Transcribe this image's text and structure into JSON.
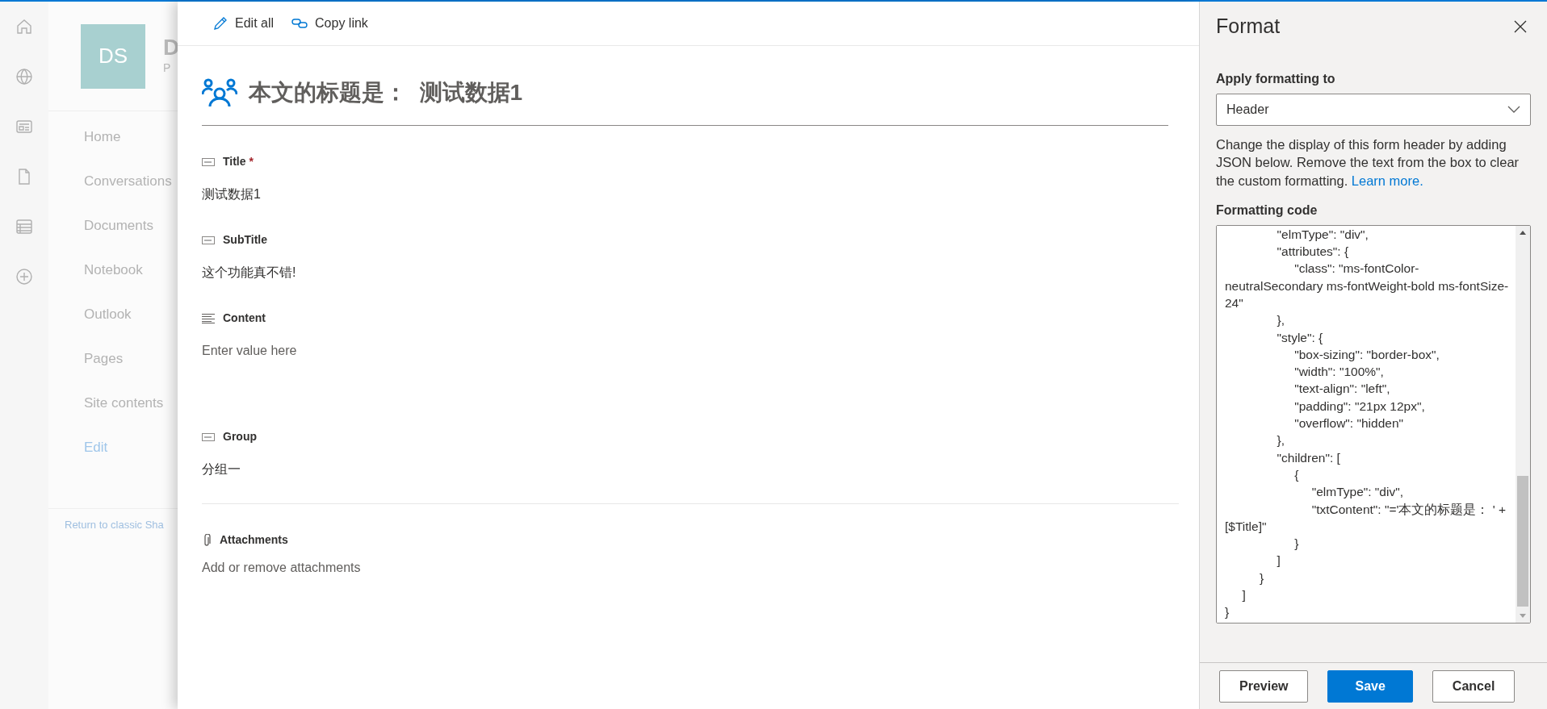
{
  "app_rail": {
    "items": [
      {
        "kind": "home"
      },
      {
        "kind": "globe"
      },
      {
        "kind": "news"
      },
      {
        "kind": "file"
      },
      {
        "kind": "list"
      },
      {
        "kind": "add"
      }
    ]
  },
  "site": {
    "logo": "DS",
    "title": "D",
    "subtitle": "P",
    "nav": [
      {
        "label": "Home",
        "kind": "link"
      },
      {
        "label": "Conversations",
        "kind": "link"
      },
      {
        "label": "Documents",
        "kind": "link"
      },
      {
        "label": "Notebook",
        "kind": "link"
      },
      {
        "label": "Outlook",
        "kind": "link"
      },
      {
        "label": "Pages",
        "kind": "link"
      },
      {
        "label": "Site contents",
        "kind": "link"
      },
      {
        "label": "Edit",
        "kind": "action"
      }
    ],
    "classic_link": "Return to classic Sha"
  },
  "form": {
    "toolbar": [
      {
        "label": "Edit all",
        "kind": "edit"
      },
      {
        "label": "Copy link",
        "kind": "link"
      }
    ],
    "header": "本文的标题是：  测试数据1",
    "fields": [
      {
        "label": "Title",
        "kind": "text",
        "required_mark": "*",
        "value": "测试数据1"
      },
      {
        "label": "SubTitle",
        "kind": "text",
        "value": "这个功能真不错!"
      },
      {
        "label": "Content",
        "kind": "multiline",
        "placeholder": "Enter value here"
      },
      {
        "label": "Group",
        "kind": "text",
        "value": "分组一"
      }
    ],
    "attachments": {
      "label": "Attachments",
      "action": "Add or remove attachments"
    }
  },
  "format_panel": {
    "title": "Format",
    "apply_label": "Apply formatting to",
    "apply_value": "Header",
    "description": "Change the display of this form header by adding JSON below. Remove the text from the box to clear the custom formatting.",
    "learn_more": "Learn more.",
    "code_label": "Formatting code",
    "code_lines": [
      "               \"elmType\": \"div\",",
      "               \"attributes\": {",
      "                    \"class\": \"ms-fontColor-neutralSecondary ms-fontWeight-bold ms-fontSize-24\"",
      "               },",
      "               \"style\": {",
      "                    \"box-sizing\": \"border-box\",",
      "                    \"width\": \"100%\",",
      "                    \"text-align\": \"left\",",
      "                    \"padding\": \"21px 12px\",",
      "                    \"overflow\": \"hidden\"",
      "               },",
      "               \"children\": [",
      "                    {",
      "                         \"elmType\": \"div\",",
      "                         \"txtContent\": \"='本文的标题是： ' + [$Title]\"",
      "                    }",
      "               ]",
      "          }",
      "     ]",
      "}"
    ],
    "buttons": [
      {
        "label": "Preview",
        "kind": "secondary"
      },
      {
        "label": "Save",
        "kind": "primary"
      },
      {
        "label": "Cancel",
        "kind": "secondary"
      }
    ]
  }
}
